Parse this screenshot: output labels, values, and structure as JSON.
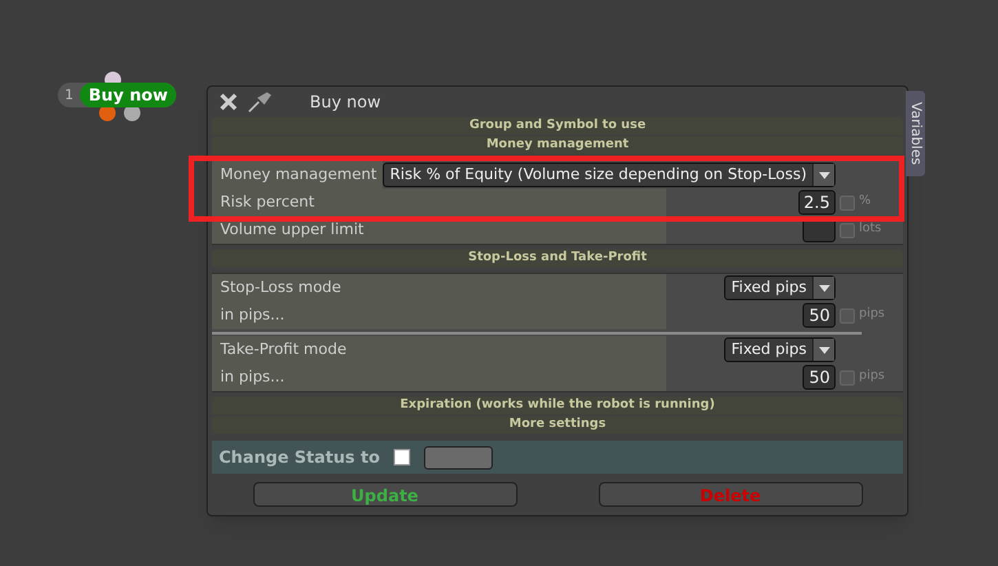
{
  "node": {
    "number": "1",
    "label": "Buy now"
  },
  "dialog": {
    "title": "Buy now",
    "side_tab": "Variables",
    "sections": [
      {
        "title": "Group and Symbol to use"
      },
      {
        "title": "Money management",
        "rows": [
          {
            "kind": "select",
            "label": "Money management",
            "value": "Risk % of Equity (Volume size depending on Stop-Loss)"
          },
          {
            "kind": "number",
            "label": "Risk percent",
            "value": "2.5",
            "unit": "%",
            "checked": false
          },
          {
            "kind": "number",
            "label": "Volume upper limit",
            "unit": "lots",
            "checked": false
          }
        ]
      },
      {
        "title": "Stop-Loss and Take-Profit",
        "rows": [
          {
            "kind": "select",
            "label": "Stop-Loss mode",
            "value": "Fixed pips"
          },
          {
            "kind": "number",
            "label": "in pips...",
            "value": "50",
            "unit": "pips",
            "checked": false
          },
          {
            "kind": "divider"
          },
          {
            "kind": "select",
            "label": "Take-Profit mode",
            "value": "Fixed pips"
          },
          {
            "kind": "number",
            "label": "in pips...",
            "value": "50",
            "unit": "pips",
            "checked": false
          }
        ]
      },
      {
        "title": "Expiration (works while the robot is running)"
      },
      {
        "title": "More settings"
      }
    ],
    "status": {
      "label": "Change Status to",
      "checked": false
    },
    "buttons": [
      {
        "label": "Update",
        "color": "#3cb043"
      },
      {
        "label": "Delete",
        "color": "#cc0000"
      }
    ]
  }
}
